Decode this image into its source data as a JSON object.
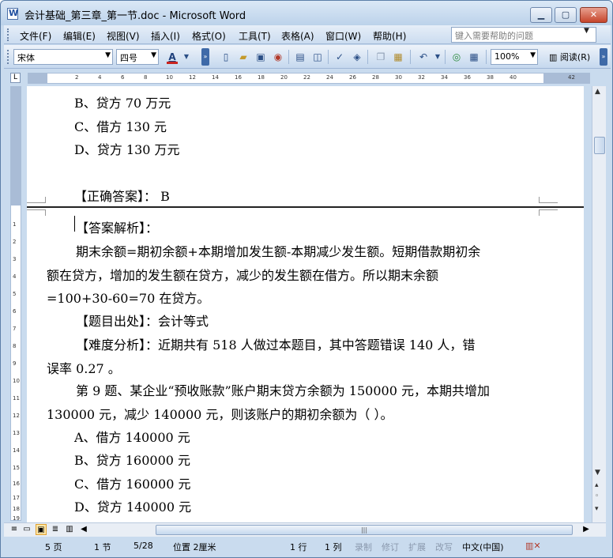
{
  "window": {
    "title": "会计基础_第三章_第一节.doc - Microsoft Word",
    "minimize": "▁",
    "maximize": "▢",
    "close": "✕"
  },
  "menu": {
    "items": [
      "文件(F)",
      "编辑(E)",
      "视图(V)",
      "插入(I)",
      "格式(O)",
      "工具(T)",
      "表格(A)",
      "窗口(W)",
      "帮助(H)"
    ],
    "help_placeholder": "键入需要帮助的问题"
  },
  "toolbar": {
    "font_name": "宋体",
    "font_size": "四号",
    "font_color_label": "A",
    "zoom": "100%",
    "read_label": "阅读(R)",
    "icons": [
      "new-document-icon",
      "open-folder-icon",
      "save-icon",
      "permission-icon",
      "print-icon",
      "print-preview-icon",
      "spelling-icon",
      "research-icon",
      "copy-icon",
      "paste-icon",
      "undo-icon",
      "hyperlink-icon",
      "table-icon"
    ]
  },
  "ruler": {
    "ticks": [
      "2",
      "4",
      "6",
      "8",
      "10",
      "12",
      "14",
      "16",
      "18",
      "20",
      "22",
      "24",
      "26",
      "28",
      "30",
      "32",
      "34",
      "36",
      "38",
      "40",
      "42"
    ],
    "vticks": [
      "1",
      "2",
      "3",
      "4",
      "5",
      "6",
      "7",
      "8",
      "9",
      "10",
      "11",
      "12",
      "13",
      "14",
      "15",
      "16",
      "17",
      "18",
      "19"
    ]
  },
  "document": {
    "option_b_prev": "B、贷方 70 万元",
    "option_c_prev": "C、借方 130 元",
    "option_d_prev": "D、贷方 130 万元",
    "correct_answer": "【正确答案】：  B",
    "analysis_title": "【答案解析】：",
    "analysis_line1": "期末余额=期初余额+本期增加发生额-本期减少发生额。短期借款期初余",
    "analysis_line2": "额在贷方，增加的发生额在贷方，减少的发生额在借方。所以期末余额",
    "analysis_line3": "=100+30-60=70 在贷方。",
    "source": "【题目出处】：会计等式",
    "difficulty_line1": "【难度分析】：近期共有  518  人做过本题目，其中答题错误  140  人，错",
    "difficulty_line2": "误率 0.27  。",
    "q9_line1": "第 9  题、某企业“预收账款”账户期末贷方余额为 150000 元，本期共增加",
    "q9_line2": "130000 元，减少 140000 元，则该账户的期初余额为（  ）。",
    "option_a": "A、借方 140000 元",
    "option_b": "B、贷方 160000 元",
    "option_c": "C、借方 160000 元",
    "option_d": "D、贷方 140000 元"
  },
  "statusbar": {
    "page": "5 页",
    "section": "1 节",
    "page_of": "5/28",
    "position": "位置 2厘米",
    "line": "1 行",
    "column": "1 列",
    "rec": "录制",
    "trk": "修订",
    "ext": "扩展",
    "ovr": "改写",
    "language": "中文(中国)"
  }
}
